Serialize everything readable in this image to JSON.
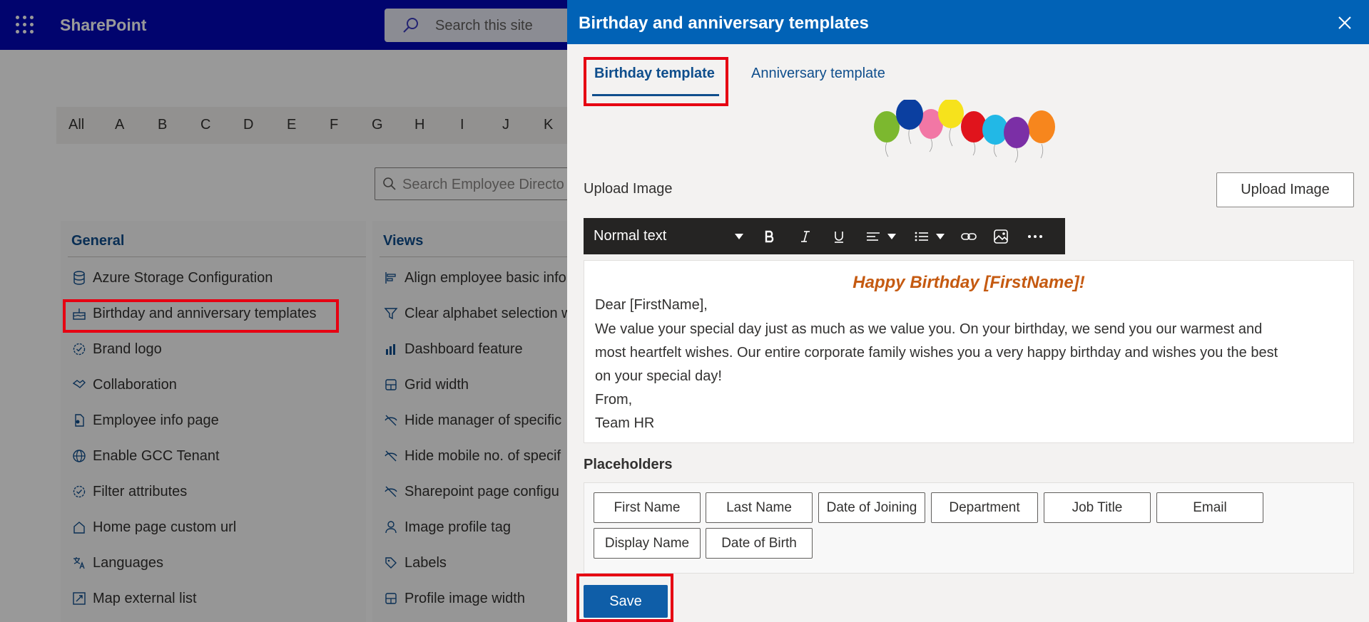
{
  "app": {
    "brand": "SharePoint"
  },
  "site_search": {
    "placeholder": "Search this site"
  },
  "alphabet": [
    "All",
    "A",
    "B",
    "C",
    "D",
    "E",
    "F",
    "G",
    "H",
    "I",
    "J",
    "K"
  ],
  "employee_search": {
    "placeholder": "Search Employee Directo"
  },
  "settings": {
    "general": {
      "heading": "General",
      "items": [
        {
          "label": "Azure Storage Configuration",
          "icon": "database-icon"
        },
        {
          "label": "Birthday and anniversary templates",
          "icon": "cake-icon"
        },
        {
          "label": "Brand logo",
          "icon": "badge-icon"
        },
        {
          "label": "Collaboration",
          "icon": "handshake-icon"
        },
        {
          "label": "Employee info page",
          "icon": "person-doc-icon"
        },
        {
          "label": "Enable GCC Tenant",
          "icon": "globe-icon"
        },
        {
          "label": "Filter attributes",
          "icon": "badge-icon"
        },
        {
          "label": "Home page custom url",
          "icon": "home-icon"
        },
        {
          "label": "Languages",
          "icon": "translate-icon"
        },
        {
          "label": "Map external list",
          "icon": "map-icon"
        }
      ]
    },
    "views": {
      "heading": "Views",
      "items": [
        {
          "label": "Align employee basic info",
          "icon": "align-icon"
        },
        {
          "label": "Clear alphabet selection w",
          "icon": "filter-icon"
        },
        {
          "label": "Dashboard feature",
          "icon": "chart-icon"
        },
        {
          "label": "Grid width",
          "icon": "grid-icon"
        },
        {
          "label": "Hide manager of specific",
          "icon": "eye-off-icon"
        },
        {
          "label": "Hide mobile no. of specif",
          "icon": "eye-off-icon"
        },
        {
          "label": "Sharepoint page configu",
          "icon": "eye-off-icon"
        },
        {
          "label": "Image profile tag",
          "icon": "person-icon"
        },
        {
          "label": "Labels",
          "icon": "tag-icon"
        },
        {
          "label": "Profile image width",
          "icon": "grid-icon"
        }
      ]
    }
  },
  "panel": {
    "title": "Birthday and anniversary templates",
    "tabs": [
      {
        "label": "Birthday template",
        "active": true
      },
      {
        "label": "Anniversary template",
        "active": false
      }
    ],
    "upload_label": "Upload Image",
    "upload_button": "Upload Image",
    "toolbar": {
      "style": "Normal text",
      "buttons": [
        "bold-icon",
        "italic-icon",
        "underline-icon",
        "align-icon",
        "list-icon",
        "link-icon",
        "image-icon",
        "more-icon"
      ]
    },
    "editor": {
      "heading": "Happy Birthday [FirstName]!",
      "lines": [
        "Dear [FirstName],",
        "We value your special day just as much as we value you. On your birthday, we send you our warmest and",
        "most heartfelt wishes. Our entire corporate family wishes you a very happy birthday and wishes you the best",
        "on your special day!",
        "From,",
        "Team HR"
      ]
    },
    "placeholders_label": "Placeholders",
    "placeholders": [
      "First Name",
      "Last Name",
      "Date of Joining",
      "Department",
      "Job Title",
      "Email",
      "Display Name",
      "Date of Birth"
    ],
    "save": "Save"
  },
  "colors": {
    "topbar": "#0308b8",
    "panel_header": "#0162b6",
    "accent": "#0f4e8c",
    "highlight": "#e60012",
    "heading_text": "#c55a11"
  }
}
